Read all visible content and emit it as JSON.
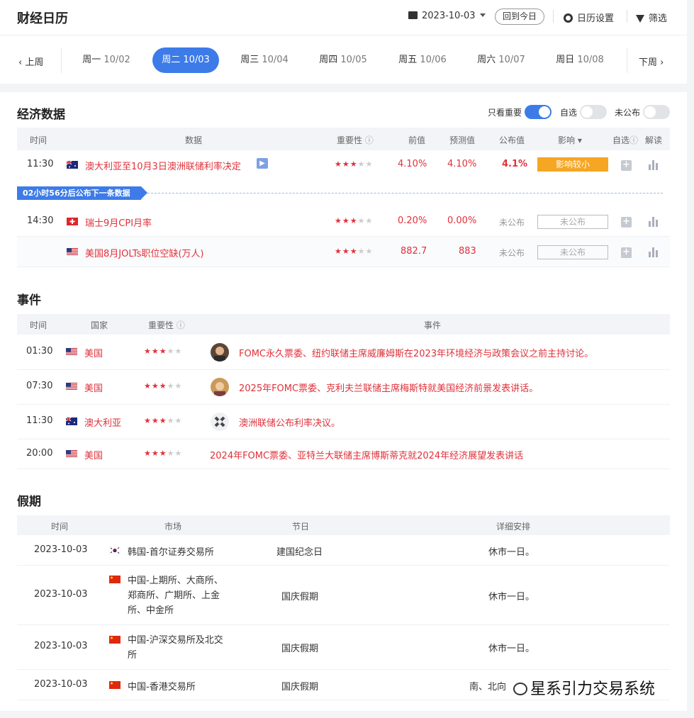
{
  "header": {
    "title": "财经日历",
    "date": "2023-10-03",
    "today": "回到今日",
    "settings": "日历设置",
    "filter": "筛选"
  },
  "week": {
    "prev": "上周",
    "next": "下周",
    "days": [
      {
        "name": "周一",
        "date": "10/02"
      },
      {
        "name": "周二",
        "date": "10/03"
      },
      {
        "name": "周三",
        "date": "10/04"
      },
      {
        "name": "周四",
        "date": "10/05"
      },
      {
        "name": "周五",
        "date": "10/06"
      },
      {
        "name": "周六",
        "date": "10/07"
      },
      {
        "name": "周日",
        "date": "10/08"
      }
    ]
  },
  "econ": {
    "title": "经济数据",
    "toggles": {
      "important": "只看重要",
      "mine": "自选",
      "unpub": "未公布"
    },
    "headers": {
      "time": "时间",
      "data": "数据",
      "importance": "重要性",
      "prev": "前值",
      "forecast": "预测值",
      "actual": "公布值",
      "impact": "影响",
      "mine": "自选",
      "explain": "解读"
    },
    "banner": "02小时56分后公布下一条数据",
    "rows": [
      {
        "time": "11:30",
        "name": "澳大利亚至10月3日澳洲联储利率决定",
        "prev": "4.10%",
        "forecast": "4.10%",
        "actual": "4.1%",
        "impact": "影响较小"
      },
      {
        "time": "14:30",
        "name": "瑞士9月CPI月率",
        "prev": "0.20%",
        "forecast": "0.00%",
        "actual": "未公布",
        "impact": "未公布"
      },
      {
        "time": "",
        "name": "美国8月JOLTs职位空缺(万人)",
        "prev": "882.7",
        "forecast": "883",
        "actual": "未公布",
        "impact": "未公布"
      }
    ]
  },
  "events": {
    "title": "事件",
    "headers": {
      "time": "时间",
      "country": "国家",
      "importance": "重要性",
      "event": "事件"
    },
    "rows": [
      {
        "time": "01:30",
        "country": "美国",
        "text": "FOMC永久票委、纽约联储主席威廉姆斯在2023年环境经济与政策会议之前主持讨论。"
      },
      {
        "time": "07:30",
        "country": "美国",
        "text": "2025年FOMC票委、克利夫兰联储主席梅斯特就美国经济前景发表讲话。"
      },
      {
        "time": "11:30",
        "country": "澳大利亚",
        "text": "澳洲联储公布利率决议。"
      },
      {
        "time": "20:00",
        "country": "美国",
        "text": "2024年FOMC票委、亚特兰大联储主席博斯蒂克就2024年经济展望发表讲话"
      }
    ]
  },
  "holidays": {
    "title": "假期",
    "headers": {
      "time": "时间",
      "market": "市场",
      "holiday": "节日",
      "detail": "详细安排"
    },
    "rows": [
      {
        "date": "2023-10-03",
        "market": [
          "韩国-首尔证券交易所"
        ],
        "holiday": "建国纪念日",
        "detail": "休市一日。"
      },
      {
        "date": "2023-10-03",
        "market": [
          "中国-上期所、大商所、",
          "郑商所、广期所、上金",
          "所、中金所"
        ],
        "holiday": "国庆假期",
        "detail": "休市一日。"
      },
      {
        "date": "2023-10-03",
        "market": [
          "中国-沪深交易所及北交",
          "所"
        ],
        "holiday": "国庆假期",
        "detail": "休市一日。"
      },
      {
        "date": "2023-10-03",
        "market": [
          "中国-香港交易所"
        ],
        "holiday": "国庆假期",
        "detail": "南、北向"
      }
    ]
  },
  "footer": "星系引力交易系统"
}
